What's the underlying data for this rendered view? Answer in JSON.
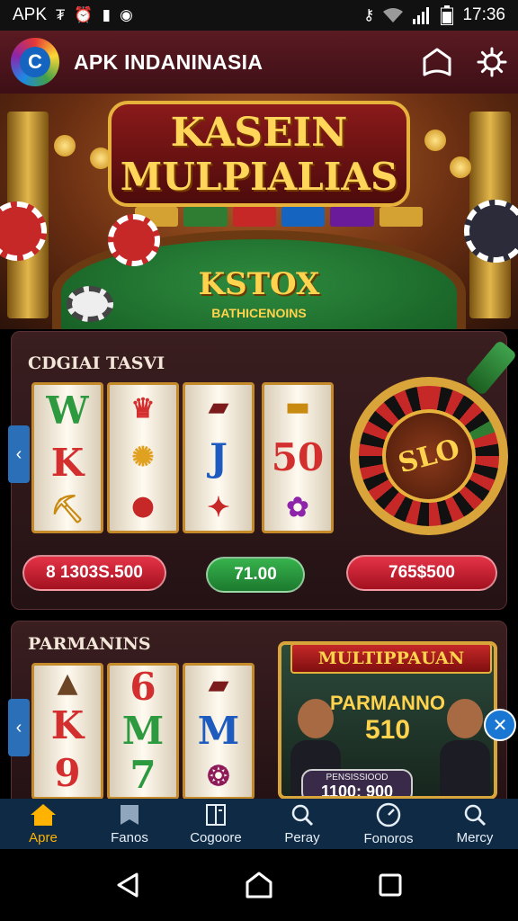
{
  "status_bar": {
    "app_label": "APK",
    "time": "17:36"
  },
  "app_bar": {
    "title": "APK INDANINASIA"
  },
  "hero": {
    "title_line1": "KASEIN",
    "title_line2": "MULPIALIAS",
    "table_title": "KSTOX",
    "table_subtitle": "BATHICENOINS"
  },
  "section1": {
    "title": "CDGIAI TASVI",
    "reel_symbols": [
      [
        "W",
        "K"
      ],
      [
        "",
        ""
      ],
      [
        "",
        "J"
      ],
      [
        "",
        "50"
      ]
    ],
    "wheel_label": "SLO",
    "pills": [
      "8 1303S.500",
      "71.00",
      "765$500"
    ]
  },
  "section2": {
    "title": "PARMANINS",
    "reel_symbols": [
      [
        "K",
        "9"
      ],
      [
        "6",
        "M",
        "7"
      ],
      [
        "",
        "M"
      ]
    ],
    "promo_banner": "MULTIPPAUAN",
    "promo_name": "PARMANNO",
    "promo_number": "510",
    "promo_label_top": "PENSISSIOOD",
    "promo_label_value": "1100: 900"
  },
  "bottom_nav": [
    {
      "label": "Apre",
      "icon": "home-icon"
    },
    {
      "label": "Fanos",
      "icon": "bookmark-icon"
    },
    {
      "label": "Cogoore",
      "icon": "book-icon"
    },
    {
      "label": "Peray",
      "icon": "search-icon"
    },
    {
      "label": "Fonoros",
      "icon": "gauge-icon"
    },
    {
      "label": "Mercy",
      "icon": "search-icon"
    }
  ],
  "colors": {
    "app_bar": "#4a141b",
    "nav_bg": "#0e2a44",
    "nav_active": "#ffb300",
    "pill_red": "#c81e2e",
    "pill_green": "#2e9a40"
  }
}
